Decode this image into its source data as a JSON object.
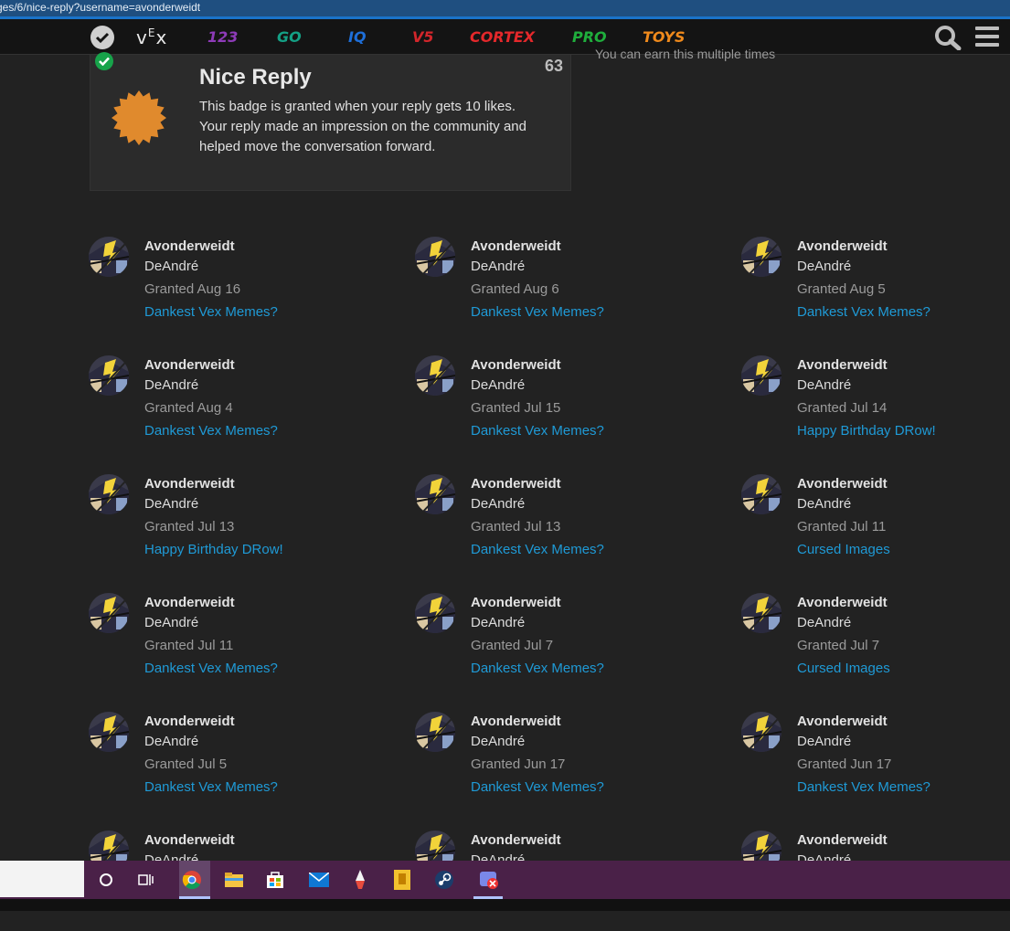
{
  "browser": {
    "url": "ges/6/nice-reply?username=avonderweidt"
  },
  "nav": {
    "logo": "vEx",
    "links": [
      {
        "label": "123",
        "color": "#8e3bb8"
      },
      {
        "label": "GO",
        "color": "#14a085"
      },
      {
        "label": "IQ",
        "color": "#1e6fd9"
      },
      {
        "label": "V5",
        "color": "#d2262b"
      },
      {
        "label": "CORTEX",
        "color": "#e5282b"
      },
      {
        "label": "PRO",
        "color": "#1fae3c"
      },
      {
        "label": "TOYS",
        "color": "#f08a1c"
      }
    ],
    "icons": [
      "check-icon",
      "search-icon",
      "hamburger-menu-icon"
    ]
  },
  "badge": {
    "title": "Nice Reply",
    "count": "63",
    "description": "This badge is granted when your reply gets 10 likes. Your reply made an impression on the community and helped move the conversation forward.",
    "icon": "badge-starburst-icon",
    "icon_color": "#e08a2d",
    "side_note": "You can earn this multiple times"
  },
  "grants": [
    {
      "username": "Avonderweidt",
      "name": "DeAndré",
      "granted": "Granted Aug 16",
      "topic": "Dankest Vex Memes?"
    },
    {
      "username": "Avonderweidt",
      "name": "DeAndré",
      "granted": "Granted Aug 6",
      "topic": "Dankest Vex Memes?"
    },
    {
      "username": "Avonderweidt",
      "name": "DeAndré",
      "granted": "Granted Aug 5",
      "topic": "Dankest Vex Memes?"
    },
    {
      "username": "Avonderweidt",
      "name": "DeAndré",
      "granted": "Granted Aug 4",
      "topic": "Dankest Vex Memes?"
    },
    {
      "username": "Avonderweidt",
      "name": "DeAndré",
      "granted": "Granted Jul 15",
      "topic": "Dankest Vex Memes?"
    },
    {
      "username": "Avonderweidt",
      "name": "DeAndré",
      "granted": "Granted Jul 14",
      "topic": "Happy Birthday DRow!"
    },
    {
      "username": "Avonderweidt",
      "name": "DeAndré",
      "granted": "Granted Jul 13",
      "topic": "Happy Birthday DRow!"
    },
    {
      "username": "Avonderweidt",
      "name": "DeAndré",
      "granted": "Granted Jul 13",
      "topic": "Dankest Vex Memes?"
    },
    {
      "username": "Avonderweidt",
      "name": "DeAndré",
      "granted": "Granted Jul 11",
      "topic": "Cursed Images"
    },
    {
      "username": "Avonderweidt",
      "name": "DeAndré",
      "granted": "Granted Jul 11",
      "topic": "Dankest Vex Memes?"
    },
    {
      "username": "Avonderweidt",
      "name": "DeAndré",
      "granted": "Granted Jul 7",
      "topic": "Dankest Vex Memes?"
    },
    {
      "username": "Avonderweidt",
      "name": "DeAndré",
      "granted": "Granted Jul 7",
      "topic": "Cursed Images"
    },
    {
      "username": "Avonderweidt",
      "name": "DeAndré",
      "granted": "Granted Jul 5",
      "topic": "Dankest Vex Memes?"
    },
    {
      "username": "Avonderweidt",
      "name": "DeAndré",
      "granted": "Granted Jun 17",
      "topic": "Dankest Vex Memes?"
    },
    {
      "username": "Avonderweidt",
      "name": "DeAndré",
      "granted": "Granted Jun 17",
      "topic": "Dankest Vex Memes?"
    },
    {
      "username": "Avonderweidt",
      "name": "DeAndré",
      "granted": "",
      "topic": ""
    },
    {
      "username": "Avonderweidt",
      "name": "DeAndré",
      "granted": "",
      "topic": ""
    },
    {
      "username": "Avonderweidt",
      "name": "DeAndré",
      "granted": "",
      "topic": ""
    }
  ],
  "taskbar": {
    "icons": [
      "cortana-circle-icon",
      "task-view-icon",
      "chrome-icon",
      "file-explorer-icon",
      "store-icon",
      "mail-icon",
      "paint-icon",
      "slides-icon",
      "steam-icon",
      "app-icon"
    ]
  },
  "colors": {
    "link": "#1f9ad6",
    "background": "#222222",
    "taskbar": "#4a2148"
  }
}
